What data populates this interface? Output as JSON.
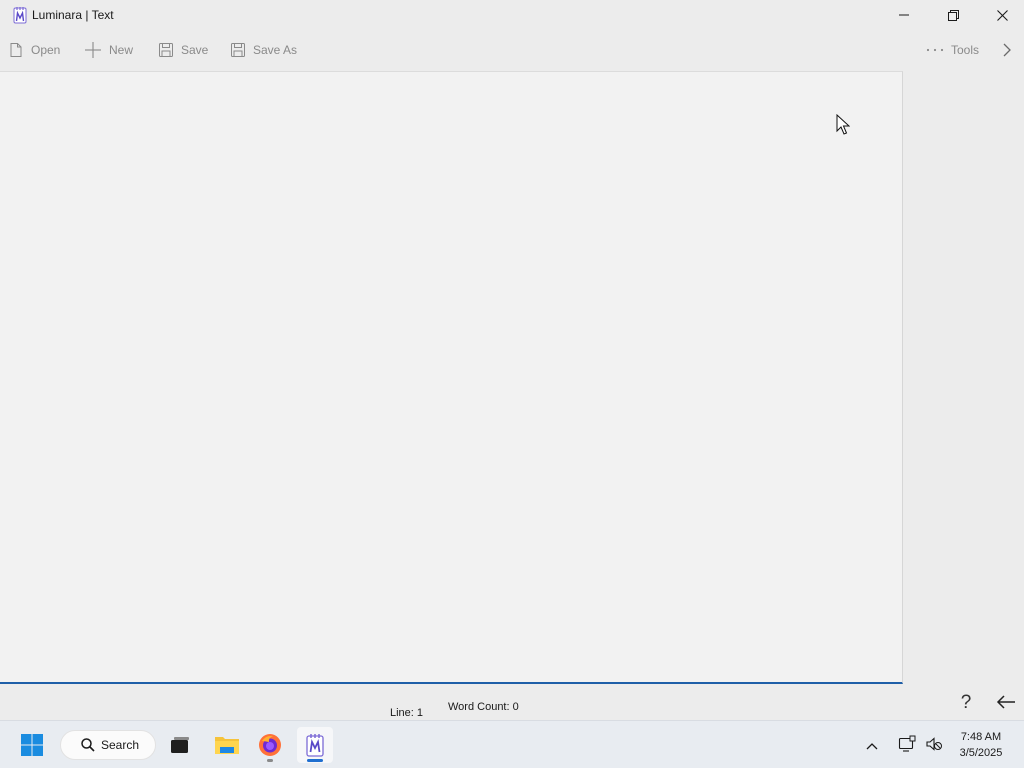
{
  "window": {
    "title": "Luminara | Text",
    "app_icon": "luminara-app-icon",
    "controls": {
      "minimize_icon": "minimize-icon",
      "restore_icon": "restore-icon",
      "close_icon": "close-icon"
    }
  },
  "toolbar": {
    "open_label": "Open",
    "new_label": "New",
    "save_label": "Save",
    "save_as_label": "Save As",
    "tools_label": "Tools",
    "more_icon": "chevron-right-icon"
  },
  "editor": {
    "content": ""
  },
  "status": {
    "line": "Line: 1",
    "word_count": "Word Count: 0",
    "help_label": "?",
    "back_icon": "arrow-left-icon"
  },
  "taskbar": {
    "search_label": "Search",
    "apps": [
      "start-icon",
      "search-icon",
      "task-view-icon",
      "file-explorer-icon",
      "firefox-icon",
      "luminara-icon"
    ],
    "clock": {
      "time": "7:48 AM",
      "date": "3/5/2025"
    }
  },
  "colors": {
    "accent": "#1f5fa8",
    "window_bg": "#ececec",
    "editor_bg": "#f2f2f2",
    "taskbar_bg": "#e8ecf1"
  }
}
